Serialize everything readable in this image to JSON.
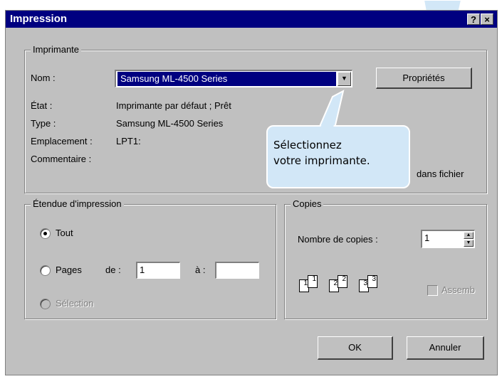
{
  "dialog": {
    "title": "Impression",
    "help_btn": "?",
    "close_btn": "×"
  },
  "printer": {
    "group_label": "Imprimante",
    "name_label": "Nom :",
    "name_value": "Samsung ML-4500 Series",
    "properties_btn": "Propriétés",
    "status_label": "État :",
    "status_value": "Imprimante par défaut ; Prêt",
    "type_label": "Type :",
    "type_value": "Samsung ML-4500 Series",
    "location_label": "Emplacement :",
    "location_value": "LPT1:",
    "comment_label": "Commentaire :",
    "print_to_file_partial": "dans fichier"
  },
  "range": {
    "group_label": "Étendue d'impression",
    "all": "Tout",
    "pages": "Pages",
    "from_label": "de :",
    "from_value": "1",
    "to_label": "à :",
    "to_value": "",
    "selection": "Sélection"
  },
  "copies": {
    "group_label": "Copies",
    "count_label": "Nombre de copies :",
    "count_value": "1",
    "collate_label": "Assemb",
    "page_labels": [
      "1",
      "1",
      "2",
      "2",
      "3",
      "3"
    ]
  },
  "buttons": {
    "ok": "OK",
    "cancel": "Annuler"
  },
  "callout": {
    "line1": "Sélectionnez",
    "line2": "votre imprimante."
  },
  "colors": {
    "title_bar": "#000080",
    "dialog_bg": "#c0c0c0",
    "callout_bg": "#d2e7f7"
  }
}
